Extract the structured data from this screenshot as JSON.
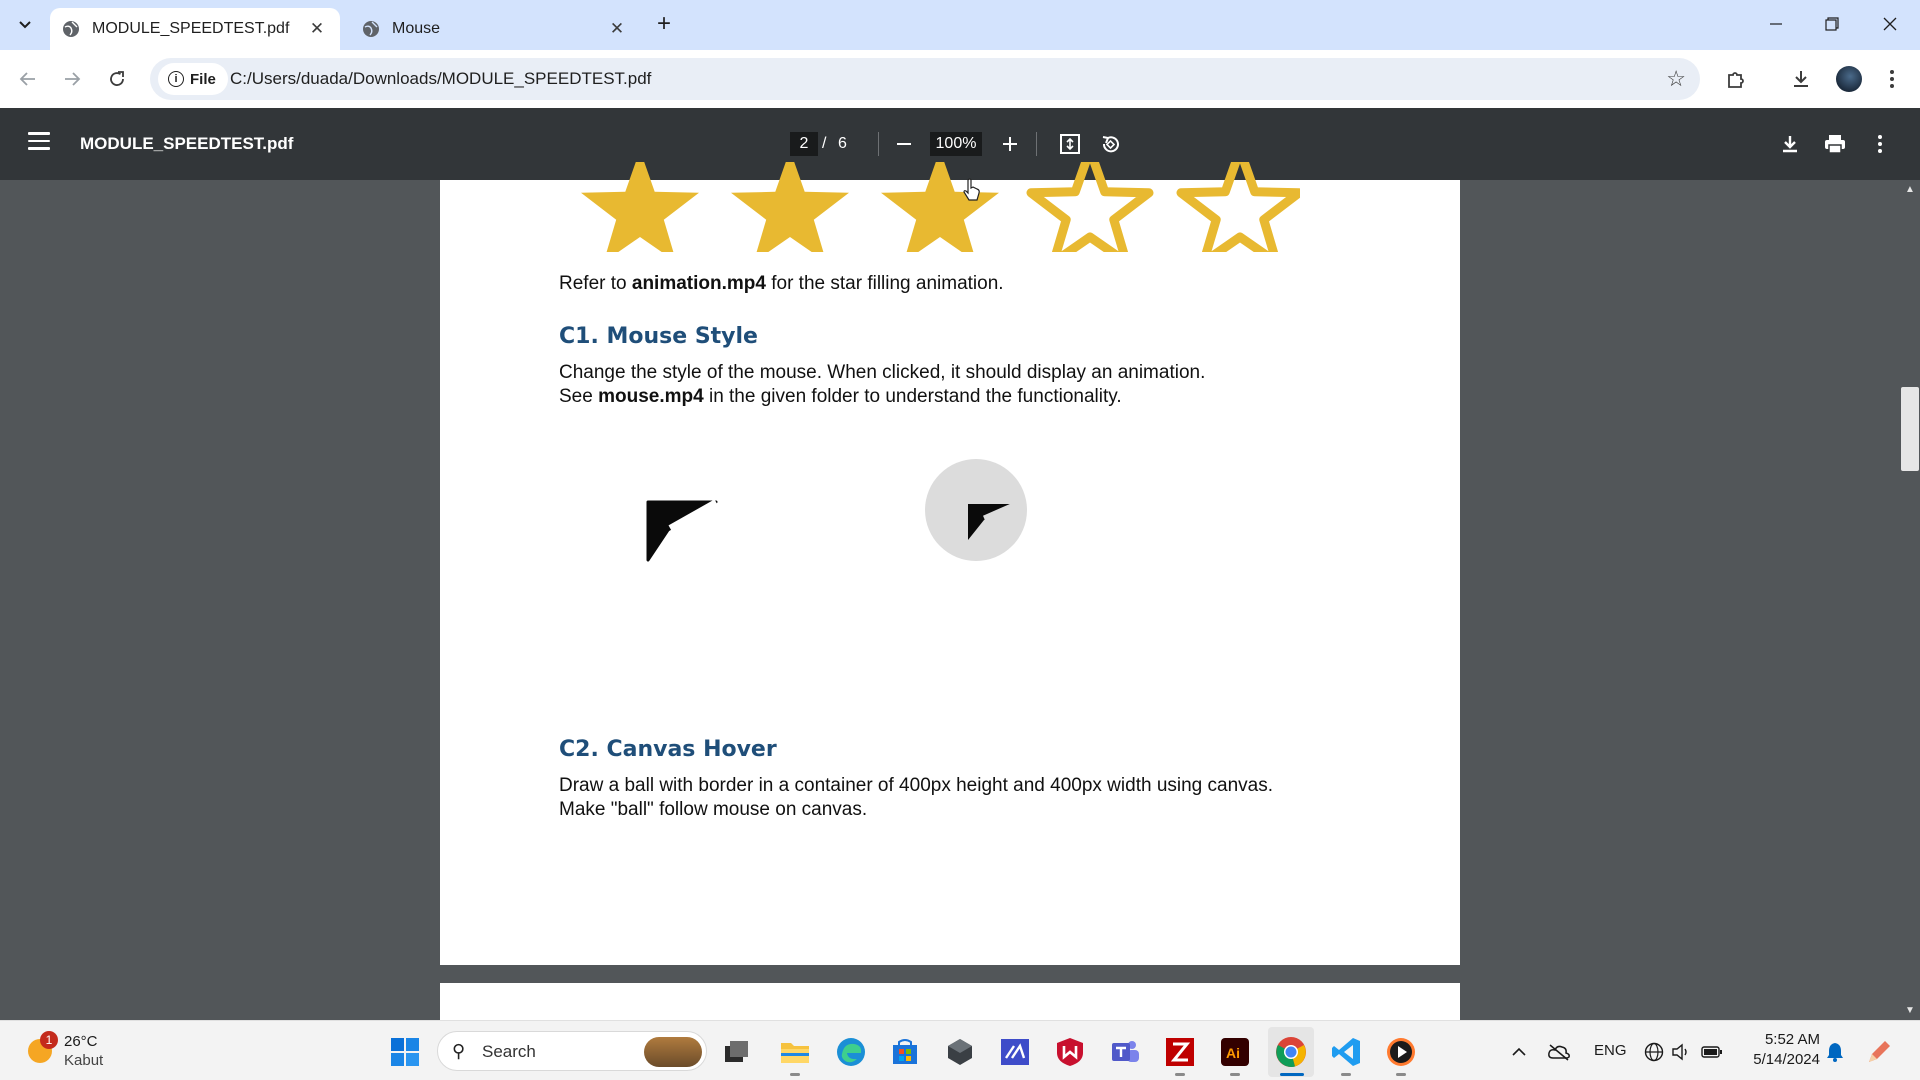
{
  "browser": {
    "tabs": [
      {
        "title": "MODULE_SPEEDTEST.pdf",
        "active": true
      },
      {
        "title": "Mouse",
        "active": false
      }
    ],
    "address": {
      "scheme_label": "File",
      "url": "C:/Users/duada/Downloads/MODULE_SPEEDTEST.pdf"
    }
  },
  "pdf_viewer": {
    "title": "MODULE_SPEEDTEST.pdf",
    "current_page": "2",
    "page_separator": "/",
    "total_pages": "6",
    "zoom": "100%"
  },
  "document": {
    "rating": {
      "filled": 3,
      "total": 5,
      "color": "#e8b931"
    },
    "refer_prefix": "Refer to ",
    "refer_file": "animation.mp4",
    "refer_suffix": " for the star filling animation.",
    "c1_heading": "C1. Mouse Style",
    "c1_line1": "Change the style of the mouse. When clicked, it should display an animation.",
    "c1_line2_prefix": "See ",
    "c1_line2_file": "mouse.mp4",
    "c1_line2_suffix": " in the given folder to understand the functionality.",
    "c2_heading": "C2. Canvas Hover",
    "c2_line1": "Draw a ball with border in a container of 400px height and 400px width using canvas.",
    "c2_line2": "Make \"ball\" follow mouse on canvas."
  },
  "taskbar": {
    "weather_badge": "1",
    "temperature": "26°C",
    "condition": "Kabut",
    "search_placeholder": "Search",
    "language": "ENG",
    "time": "5:52 AM",
    "date": "5/14/2024"
  }
}
